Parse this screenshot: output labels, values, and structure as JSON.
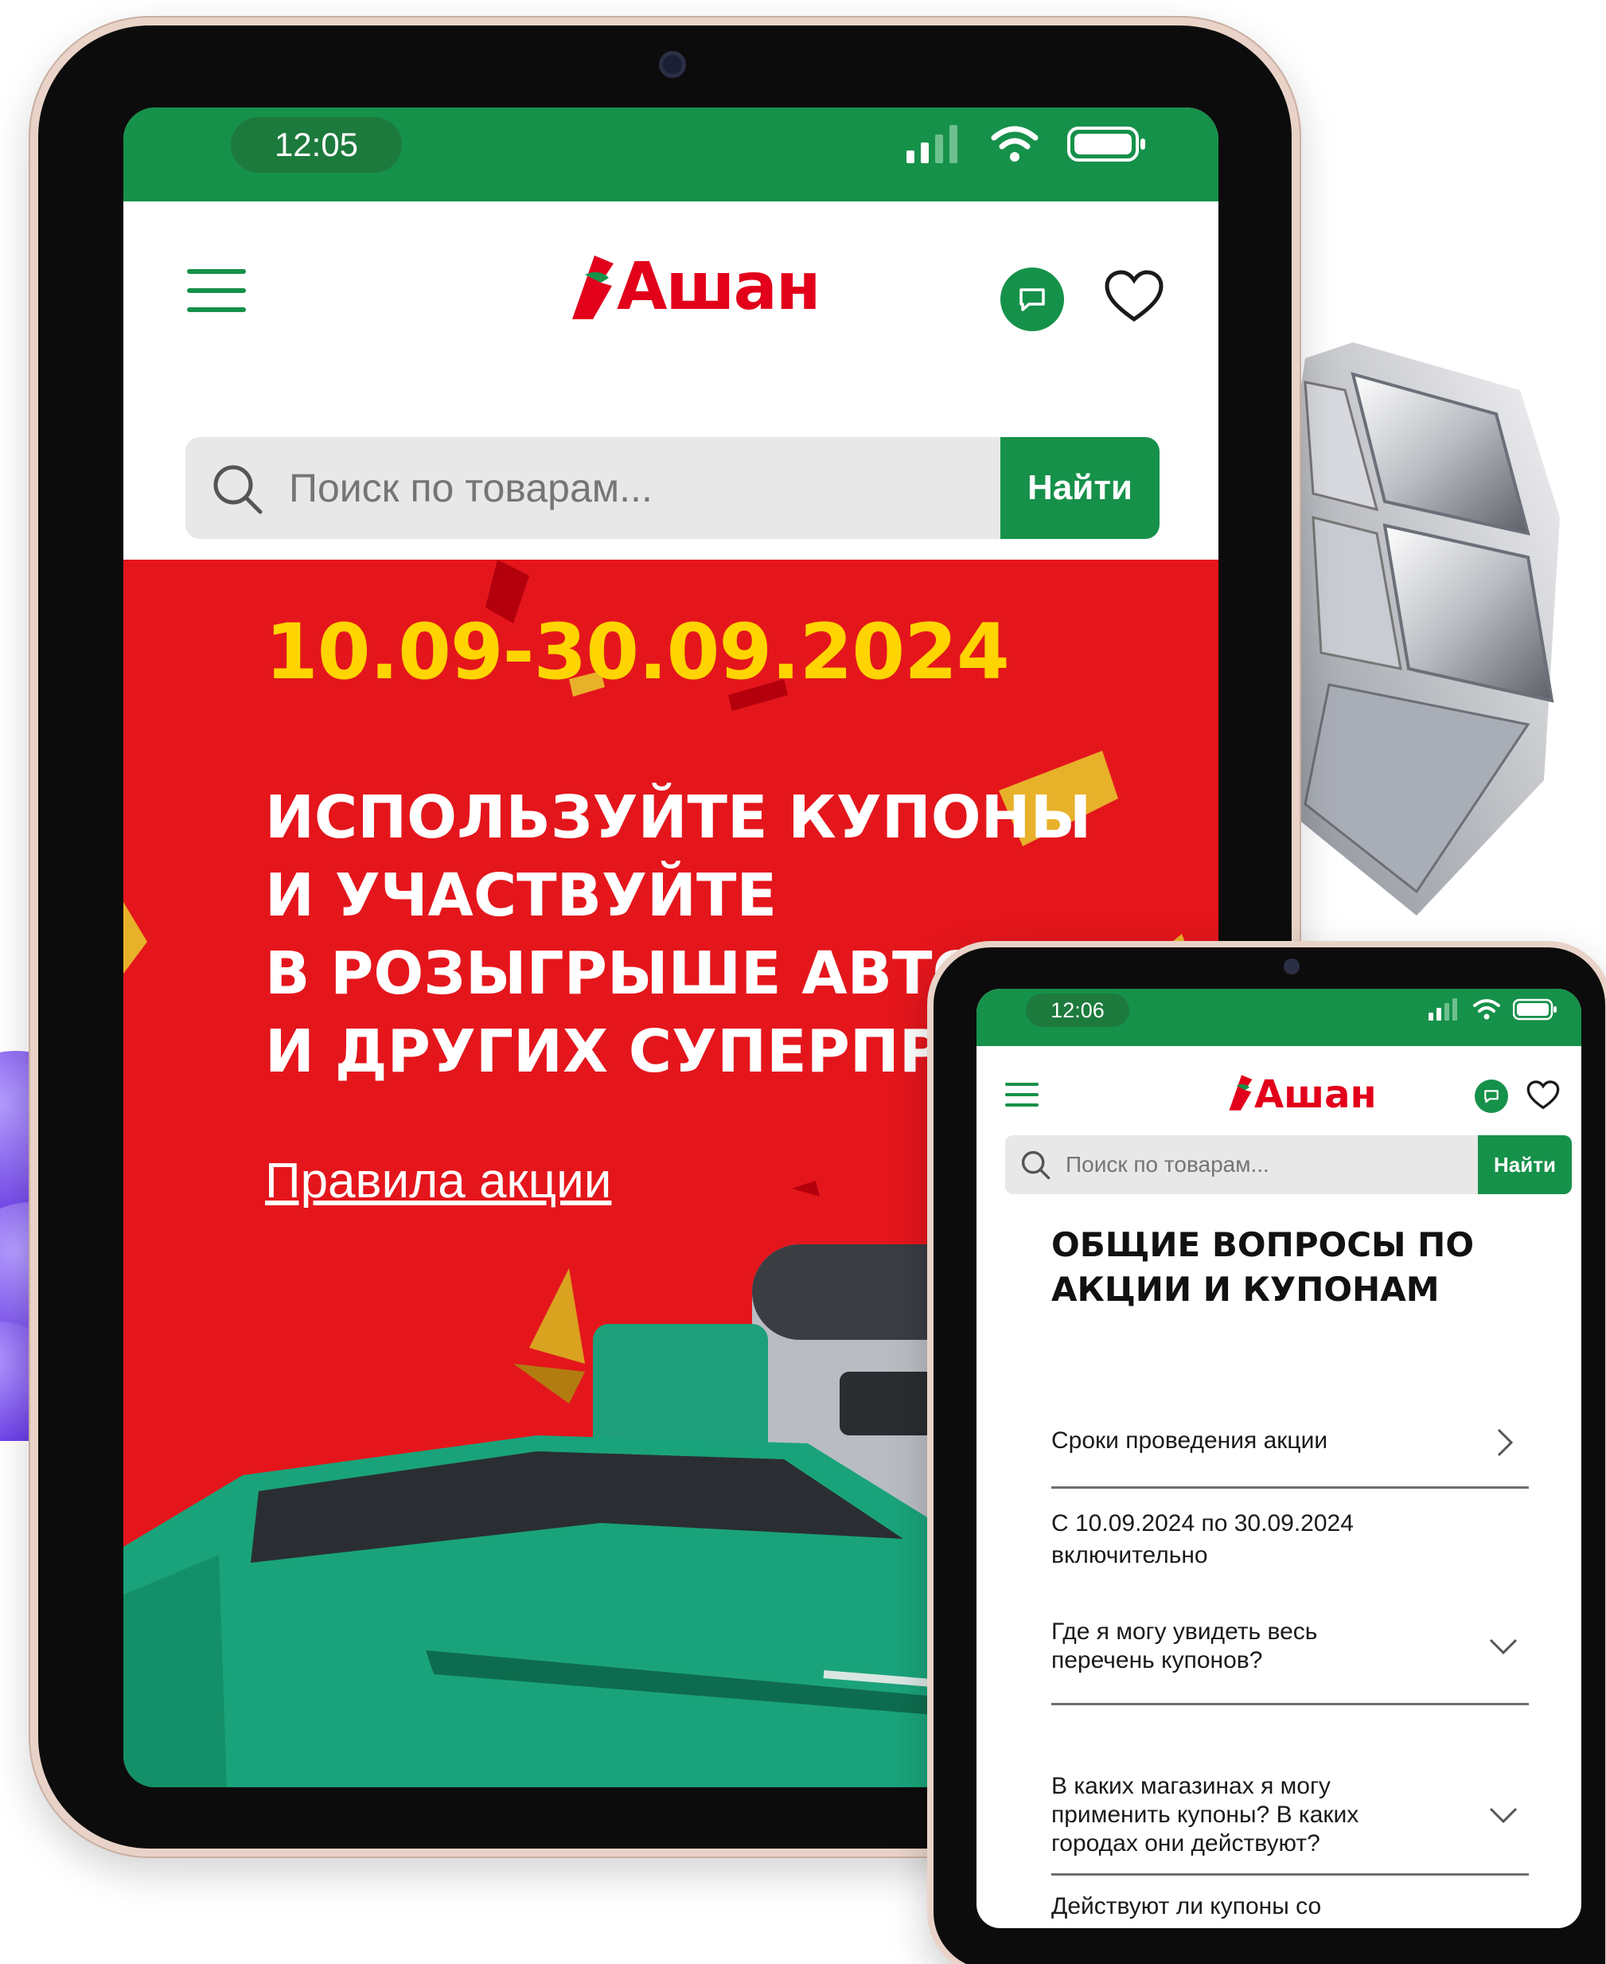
{
  "tablet": {
    "status": {
      "time": "12:05"
    },
    "header": {
      "logo_text": "Ашан"
    },
    "search": {
      "placeholder": "Поиск по товарам...",
      "button_label": "Найти"
    },
    "banner": {
      "dates": "10.09-30.09.2024",
      "headline": [
        "ИСПОЛЬЗУЙТЕ КУПОНЫ",
        "И УЧАСТВУЙТЕ",
        "В РОЗЫГРЫШЕ АВТО",
        "И ДРУГИХ СУПЕРПРИЗОВ!"
      ],
      "rules_link": "Правила акции"
    }
  },
  "phone": {
    "status": {
      "time": "12:06"
    },
    "header": {
      "logo_text": "Ашан"
    },
    "search": {
      "placeholder": "Поиск по товарам...",
      "button_label": "Найти"
    },
    "section_title": "ОБЩИЕ ВОПРОСЫ ПО АКЦИИ И КУПОНАМ",
    "faq": [
      {
        "question": "Сроки проведения акции",
        "answer": "С 10.09.2024 по 30.09.2024 включительно",
        "state": "expanded"
      },
      {
        "question": "Где я могу увидеть весь перечень купонов?",
        "answer": "",
        "state": "collapsed"
      },
      {
        "question": "В каких магазинах я могу применить купоны? В каких городах они действуют?",
        "answer": "",
        "state": "collapsed"
      }
    ],
    "faq_cut_text": "Действуют ли купоны со"
  },
  "colors": {
    "brand_green": "#16914a",
    "brand_red": "#e2001a",
    "banner_red": "#e4161c",
    "date_yellow": "#ffd400"
  },
  "icons": [
    "hamburger-icon",
    "chat-icon",
    "heart-icon",
    "search-icon",
    "signal-icon",
    "wifi-icon",
    "battery-icon",
    "chevron-right-icon",
    "chevron-down-icon"
  ]
}
